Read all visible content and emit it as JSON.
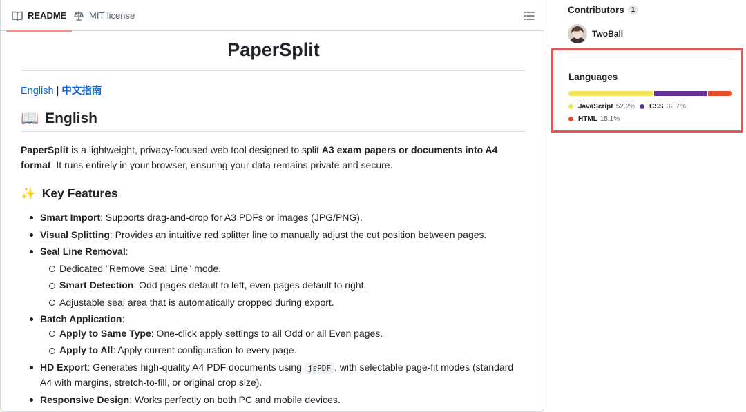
{
  "tabs": [
    {
      "label": "README",
      "icon": "book-icon",
      "active": true
    },
    {
      "label": "MIT license",
      "icon": "law-scale-icon",
      "active": false
    }
  ],
  "readme": {
    "title": "PaperSplit",
    "lang_links": {
      "english": "English",
      "separator": "|",
      "chinese": "中文指南"
    },
    "heading_english": "English",
    "heading_english_emoji": "📖",
    "intro": {
      "name": "PaperSplit",
      "text1": " is a lightweight, privacy-focused web tool designed to split ",
      "bold": "A3 exam papers or documents into A4 format",
      "text2": ". It runs entirely in your browser, ensuring your data remains private and secure."
    },
    "heading_features": "Key Features",
    "heading_features_emoji": "✨",
    "features": {
      "smart_import": {
        "label": "Smart Import",
        "text": ": Supports drag-and-drop for A3 PDFs or images (JPG/PNG)."
      },
      "visual_splitting": {
        "label": "Visual Splitting",
        "text": ": Provides an intuitive red splitter line to manually adjust the cut position between pages."
      },
      "seal_line": {
        "label": "Seal Line Removal",
        "text": ":",
        "sub": {
          "mode": {
            "text": "Dedicated \"Remove Seal Line\" mode."
          },
          "detection": {
            "label": "Smart Detection",
            "text": ": Odd pages default to left, even pages default to right."
          },
          "adjustable": {
            "text": "Adjustable seal area that is automatically cropped during export."
          }
        }
      },
      "batch": {
        "label": "Batch Application",
        "text": ":",
        "sub": {
          "same_type": {
            "label": "Apply to Same Type",
            "text": ": One-click apply settings to all Odd or all Even pages."
          },
          "all": {
            "label": "Apply to All",
            "text": ": Apply current configuration to every page."
          }
        }
      },
      "hd_export": {
        "label": "HD Export",
        "text1": ": Generates high-quality A4 PDF documents using ",
        "code": "jsPDF",
        "text2": ", with selectable page-fit modes (standard A4 with margins, stretch-to-fill, or original crop size)."
      },
      "responsive": {
        "label": "Responsive Design",
        "text": ": Works perfectly on both PC and mobile devices."
      }
    }
  },
  "sidebar": {
    "contributors_title": "Contributors",
    "contributors_count": "1",
    "contributor": {
      "name": "TwoBall"
    },
    "languages_title": "Languages",
    "languages": [
      {
        "name": "JavaScript",
        "percent": "52.2%",
        "value": 52.2,
        "color": "#f1e05a"
      },
      {
        "name": "CSS",
        "percent": "32.7%",
        "value": 32.7,
        "color": "#663399"
      },
      {
        "name": "HTML",
        "percent": "15.1%",
        "value": 15.1,
        "color": "#e34c26"
      }
    ],
    "highlight_color": "#e05757"
  }
}
